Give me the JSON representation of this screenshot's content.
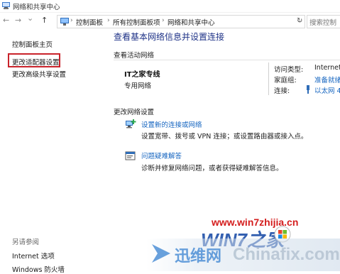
{
  "window": {
    "title": "网络和共享中心"
  },
  "navbar": {
    "back_glyph": "←",
    "forward_glyph": "→",
    "down_glyph": "⌄",
    "up_glyph": "↑",
    "breadcrumbs": [
      "控制面板",
      "所有控制面板项",
      "网络和共享中心"
    ],
    "separator": "›",
    "search_placeholder": "搜索控制"
  },
  "sidebar": {
    "home": "控制面板主页",
    "items": [
      "更改适配器设置",
      "更改高级共享设置"
    ],
    "see_also_title": "另请参阅",
    "see_also": [
      "Internet 选项",
      "Windows 防火墙"
    ]
  },
  "main": {
    "heading": "查看基本网络信息并设置连接",
    "active_title": "查看活动网络",
    "network": {
      "name": "IT之家专线",
      "type": "专用网络",
      "access_label": "访问类型:",
      "access_value": "Internet",
      "homegroup_label": "家庭组:",
      "homegroup_value": "准备就绪",
      "connection_label": "连接:",
      "connection_value": "以太网 4"
    },
    "change_title": "更改网络设置",
    "tasks": [
      {
        "icon": "network-setup-icon",
        "link": "设置新的连接或网络",
        "desc": "设置宽带、拨号或 VPN 连接；或设置路由器或接入点。"
      },
      {
        "icon": "troubleshoot-icon",
        "link": "问题疑难解答",
        "desc": "诊断并修复网络问题，或者获得疑难解答信息。"
      }
    ]
  },
  "watermarks": {
    "site": "www.win7zhijia.cn",
    "logo_text": "WIN7之家",
    "brand1": "迅维网",
    "brand2": "Chinafix.com"
  },
  "colors": {
    "accent_link": "#1565c0",
    "heading": "#1e3287",
    "highlight_box": "#c9232b"
  }
}
